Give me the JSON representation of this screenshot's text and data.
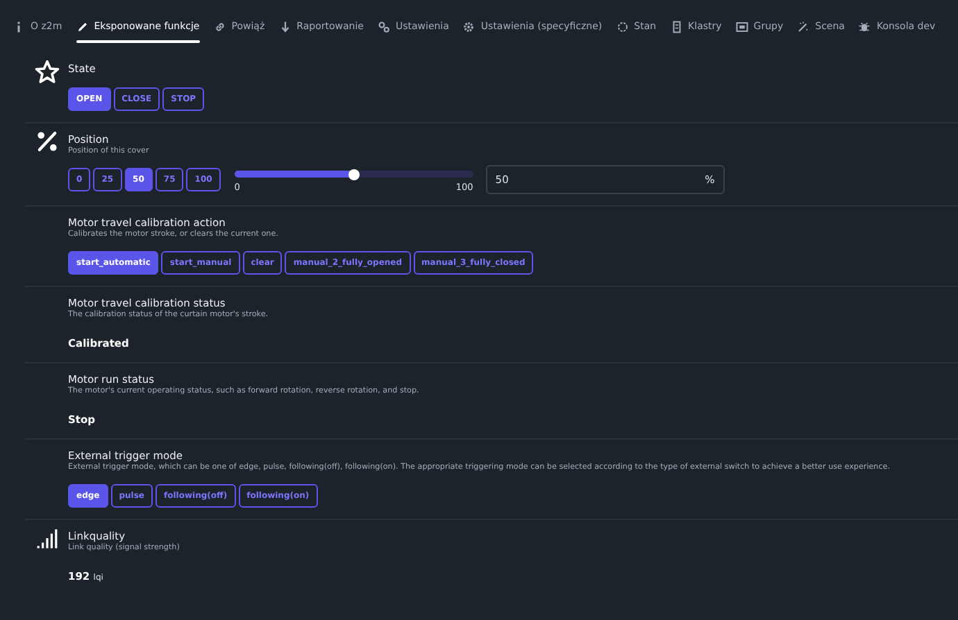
{
  "tabs": [
    {
      "label": "O z2m",
      "selected": false
    },
    {
      "label": "Eksponowane funkcje",
      "selected": true
    },
    {
      "label": "Powiąż",
      "selected": false
    },
    {
      "label": "Raportowanie",
      "selected": false
    },
    {
      "label": "Ustawienia",
      "selected": false
    },
    {
      "label": "Ustawienia (specyficzne)",
      "selected": false
    },
    {
      "label": "Stan",
      "selected": false
    },
    {
      "label": "Klastry",
      "selected": false
    },
    {
      "label": "Grupy",
      "selected": false
    },
    {
      "label": "Scena",
      "selected": false
    },
    {
      "label": "Konsola dev",
      "selected": false
    }
  ],
  "features": [
    {
      "kind": "enum",
      "title": "State",
      "options": [
        {
          "label": "OPEN",
          "selected": true
        },
        {
          "label": "CLOSE",
          "selected": false
        },
        {
          "label": "STOP",
          "selected": false
        }
      ]
    },
    {
      "kind": "numeric",
      "title": "Position",
      "description": "Position of this cover",
      "presets": [
        {
          "label": "0",
          "selected": false
        },
        {
          "label": "25",
          "selected": false
        },
        {
          "label": "50",
          "selected": true
        },
        {
          "label": "75",
          "selected": false
        },
        {
          "label": "100",
          "selected": false
        }
      ],
      "slider": {
        "level": 0.5,
        "min_label": "0",
        "max_label": "100"
      },
      "input": {
        "value": "50",
        "unit": "%"
      }
    },
    {
      "kind": "enum",
      "title": "Motor travel calibration action",
      "description": "Calibrates the motor stroke, or clears the current one.",
      "options": [
        {
          "label": "start_automatic",
          "selected": true
        },
        {
          "label": "start_manual",
          "selected": false
        },
        {
          "label": "clear",
          "selected": false
        },
        {
          "label": "manual_2_fully_opened",
          "selected": false
        },
        {
          "label": "manual_3_fully_closed",
          "selected": false
        }
      ]
    },
    {
      "kind": "text",
      "title": "Motor travel calibration status",
      "description": "The calibration status of the curtain motor's stroke.",
      "value": "Calibrated"
    },
    {
      "kind": "text",
      "title": "Motor run status",
      "description": "The motor's current operating status, such as forward rotation, reverse rotation, and stop.",
      "value": "Stop"
    },
    {
      "kind": "enum",
      "title": "External trigger mode",
      "description": "External trigger mode, which can be one of edge, pulse, following(off), following(on). The appropriate triggering mode can be selected according to the type of external switch to achieve a better use experience.",
      "options": [
        {
          "label": "edge",
          "selected": true
        },
        {
          "label": "pulse",
          "selected": false
        },
        {
          "label": "following(off)",
          "selected": false
        },
        {
          "label": "following(on)",
          "selected": false
        }
      ]
    },
    {
      "kind": "text",
      "title": "Linkquality",
      "description": "Link quality (signal strength)",
      "value": "192",
      "unit": "lqi"
    }
  ]
}
